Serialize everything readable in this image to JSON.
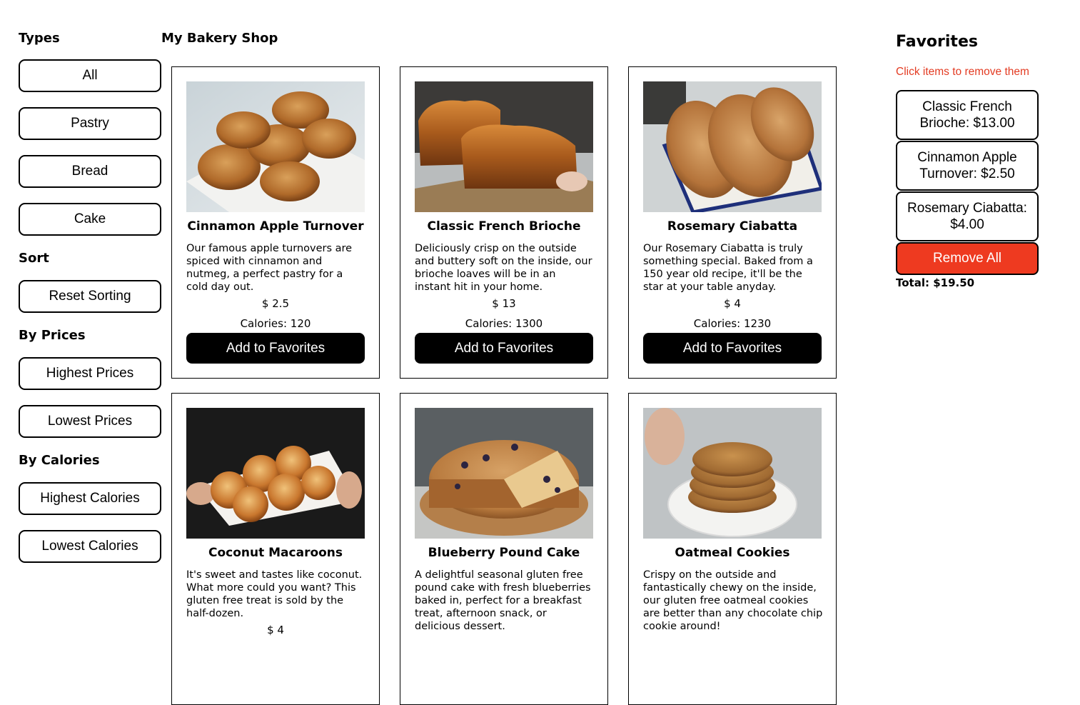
{
  "shop_title": "My Bakery Shop",
  "sidebar": {
    "types_title": "Types",
    "types": [
      "All",
      "Pastry",
      "Bread",
      "Cake"
    ],
    "sort_title": "Sort",
    "reset_label": "Reset Sorting",
    "prices_title": "By Prices",
    "prices": [
      "Highest Prices",
      "Lowest Prices"
    ],
    "calories_title": "By Calories",
    "calories": [
      "Highest Calories",
      "Lowest Calories"
    ]
  },
  "items": [
    {
      "name": "Cinnamon Apple Turnover",
      "description": "Our famous apple turnovers are spiced with cinnamon and nutmeg, a perfect pastry for a cold day out.",
      "price": "$ 2.5",
      "calories": "Calories: 120",
      "button": "Add to Favorites",
      "image": "turnover-photo"
    },
    {
      "name": "Classic French Brioche",
      "description": "Deliciously crisp on the outside and buttery soft on the inside, our brioche loaves will be in an instant hit in your home.",
      "price": "$ 13",
      "calories": "Calories: 1300",
      "button": "Add to Favorites",
      "image": "brioche-photo"
    },
    {
      "name": "Rosemary Ciabatta",
      "description": "Our Rosemary Ciabatta is truly something special. Baked from a 150 year old recipe, it'll be the star at your table anyday.",
      "price": "$ 4",
      "calories": "Calories: 1230",
      "button": "Add to Favorites",
      "image": "ciabatta-photo"
    },
    {
      "name": "Coconut Macaroons",
      "description": "It's sweet and tastes like coconut. What more could you want? This gluten free treat is sold by the half-dozen.",
      "price": "$ 4",
      "calories": "",
      "button": "",
      "image": "macaroons-photo"
    },
    {
      "name": "Blueberry Pound Cake",
      "description": "A delightful seasonal gluten free pound cake with fresh blueberries baked in, perfect for a breakfast treat, afternoon snack, or delicious dessert.",
      "price": "",
      "calories": "",
      "button": "",
      "image": "pound-cake-photo"
    },
    {
      "name": "Oatmeal Cookies",
      "description": "Crispy on the outside and fantastically chewy on the inside, our gluten free oatmeal cookies are better than any chocolate chip cookie around!",
      "price": "",
      "calories": "",
      "button": "",
      "image": "cookies-photo"
    }
  ],
  "favorites": {
    "title": "Favorites",
    "hint": "Click items to remove them",
    "items": [
      "Classic French Brioche: $13.00",
      "Cinnamon Apple Turnover: $2.50",
      "Rosemary Ciabatta: $4.00"
    ],
    "remove_all": "Remove All",
    "total": "Total: $19.50"
  },
  "colors": {
    "accent_red": "#ee3a20",
    "hint_red": "#e33b22",
    "button_black": "#000000"
  }
}
